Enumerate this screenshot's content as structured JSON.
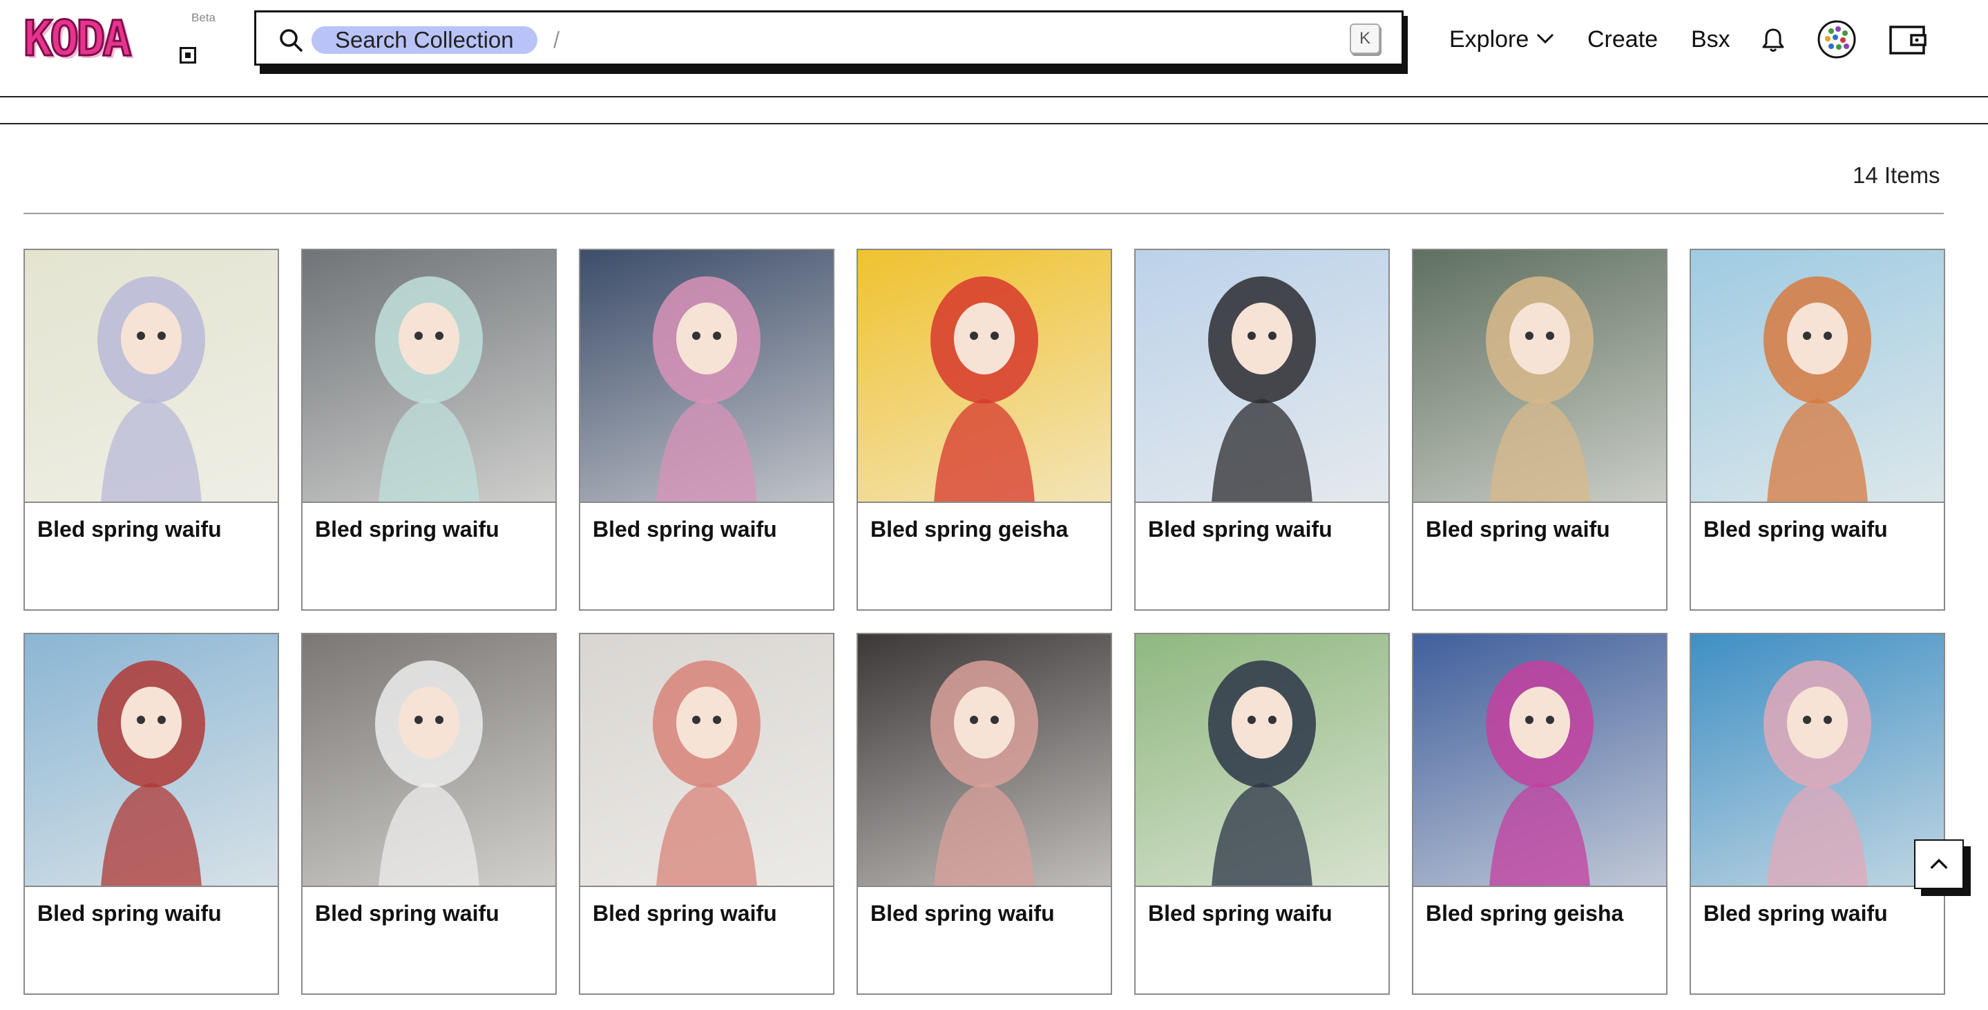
{
  "header": {
    "logo_text": "KODA",
    "beta_label": "Beta",
    "search": {
      "pill_label": "Search Collection",
      "separator": "/",
      "value": "",
      "shortcut_key": "K"
    },
    "nav": {
      "explore_label": "Explore",
      "create_label": "Create",
      "bsx_label": "Bsx"
    }
  },
  "content": {
    "items_count_label": "14 Items",
    "cards": [
      {
        "title": "Bled spring waifu",
        "thumb_bg": "#e3e4d0",
        "thumb_fg": "#b9b9d8"
      },
      {
        "title": "Bled spring waifu",
        "thumb_bg": "#6f7478",
        "thumb_fg": "#bfe0dc"
      },
      {
        "title": "Bled spring waifu",
        "thumb_bg": "#3d4d6a",
        "thumb_fg": "#d893b8"
      },
      {
        "title": "Bled spring geisha",
        "thumb_bg": "#f0c22f",
        "thumb_fg": "#d7382d"
      },
      {
        "title": "Bled spring waifu",
        "thumb_bg": "#bcd2ea",
        "thumb_fg": "#2c2c30"
      },
      {
        "title": "Bled spring waifu",
        "thumb_bg": "#5f7060",
        "thumb_fg": "#d8b98a"
      },
      {
        "title": "Bled spring waifu",
        "thumb_bg": "#9fcbe2",
        "thumb_fg": "#d77a3f"
      },
      {
        "title": "Bled spring waifu",
        "thumb_bg": "#8bb6d4",
        "thumb_fg": "#b03a36"
      },
      {
        "title": "Bled spring waifu",
        "thumb_bg": "#7a7775",
        "thumb_fg": "#ececec"
      },
      {
        "title": "Bled spring waifu",
        "thumb_bg": "#d9d6d2",
        "thumb_fg": "#d88479"
      },
      {
        "title": "Bled spring waifu",
        "thumb_bg": "#3c3838",
        "thumb_fg": "#d9a09a"
      },
      {
        "title": "Bled spring waifu",
        "thumb_bg": "#8fb880",
        "thumb_fg": "#2d3648"
      },
      {
        "title": "Bled spring geisha",
        "thumb_bg": "#405f9c",
        "thumb_fg": "#c43f9f"
      },
      {
        "title": "Bled spring waifu",
        "thumb_bg": "#3f8fc4",
        "thumb_fg": "#e2a8b8"
      }
    ]
  },
  "colors": {
    "accent_pill": "#b9c3f7",
    "logo_pink": "#e7338f",
    "border": "#8a8a8a"
  },
  "icons": {
    "search": "search-icon",
    "chevron": "chevron-down-icon",
    "bell": "bell-icon",
    "avatar": "avatar",
    "wallet": "wallet-icon",
    "scroll_top": "arrow-up-icon"
  }
}
